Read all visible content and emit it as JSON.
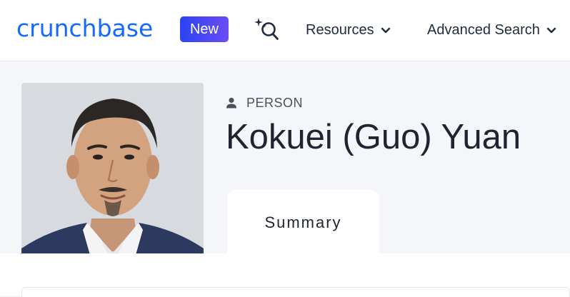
{
  "header": {
    "logo_text": "crunchbase",
    "new_badge": "New",
    "search_icon": "sparkle-search-icon",
    "nav": [
      {
        "label": "Resources",
        "icon": "chevron-down-icon"
      },
      {
        "label": "Advanced Search",
        "icon": "chevron-down-icon"
      }
    ]
  },
  "profile": {
    "type_icon": "person-icon",
    "type_label": "PERSON",
    "name": "Kokuei (Guo) Yuan",
    "photo": "profile-photo"
  },
  "tabs": [
    {
      "label": "Summary",
      "active": true
    }
  ],
  "colors": {
    "brand": "#146aff",
    "badge_start": "#2c44f2",
    "badge_end": "#6a4cf6",
    "page_bg": "#f4f6f9"
  }
}
